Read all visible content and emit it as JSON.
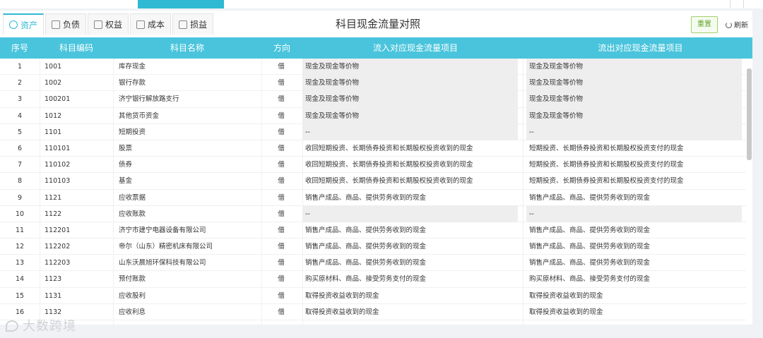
{
  "tabs": [
    {
      "label": "资产",
      "icon": "asset-icon"
    },
    {
      "label": "负债",
      "icon": "liability-icon"
    },
    {
      "label": "权益",
      "icon": "user-icon"
    },
    {
      "label": "成本",
      "icon": "layers-icon"
    },
    {
      "label": "损益",
      "icon": "profit-icon"
    }
  ],
  "page_title": "科目现金流量对照",
  "actions": {
    "reset_label": "重置",
    "refresh_label": "刷新"
  },
  "table": {
    "headers": {
      "no": "序号",
      "code": "科目编码",
      "name": "科目名称",
      "dir": "方向",
      "in": "流入对应现金流量项目",
      "out": "流出对应现金流量项目"
    },
    "rows": [
      {
        "no": "1",
        "code": "1001",
        "name": "库存现金",
        "dir": "借",
        "in": "现金及现金等价物",
        "out": "现金及现金等价物",
        "boxed": true
      },
      {
        "no": "2",
        "code": "1002",
        "name": "银行存款",
        "dir": "借",
        "in": "现金及现金等价物",
        "out": "现金及现金等价物",
        "boxed": true
      },
      {
        "no": "3",
        "code": "100201",
        "name": "济宁银行解放路支行",
        "dir": "借",
        "in": "现金及现金等价物",
        "out": "现金及现金等价物",
        "boxed": true
      },
      {
        "no": "4",
        "code": "1012",
        "name": "其他货币资金",
        "dir": "借",
        "in": "现金及现金等价物",
        "out": "现金及现金等价物",
        "boxed": true
      },
      {
        "no": "5",
        "code": "1101",
        "name": "短期投资",
        "dir": "借",
        "in": "--",
        "out": "--",
        "boxed": true
      },
      {
        "no": "6",
        "code": "110101",
        "name": "股票",
        "dir": "借",
        "in": "收回短期投资、长期债券投资和长期股权投资收到的现金",
        "out": "短期投资、长期债券投资和长期股权投资支付的现金",
        "boxed": false
      },
      {
        "no": "7",
        "code": "110102",
        "name": "债券",
        "dir": "借",
        "in": "收回短期投资、长期债券投资和长期股权投资收到的现金",
        "out": "短期投资、长期债券投资和长期股权投资支付的现金",
        "boxed": false
      },
      {
        "no": "8",
        "code": "110103",
        "name": "基金",
        "dir": "借",
        "in": "收回短期投资、长期债券投资和长期股权投资收到的现金",
        "out": "短期投资、长期债券投资和长期股权投资支付的现金",
        "boxed": false
      },
      {
        "no": "9",
        "code": "1121",
        "name": "应收票据",
        "dir": "借",
        "in": "销售产成品、商品、提供劳务收到的现金",
        "out": "销售产成品、商品、提供劳务收到的现金",
        "boxed": false
      },
      {
        "no": "10",
        "code": "1122",
        "name": "应收账款",
        "dir": "借",
        "in": "--",
        "out": "--",
        "boxed": true
      },
      {
        "no": "11",
        "code": "112201",
        "name": "济宁市建宁电器设备有限公司",
        "dir": "借",
        "in": "销售产成品、商品、提供劳务收到的现金",
        "out": "销售产成品、商品、提供劳务收到的现金",
        "boxed": false
      },
      {
        "no": "12",
        "code": "112202",
        "name": "帝尔（山东）精密机床有限公司",
        "dir": "借",
        "in": "销售产成品、商品、提供劳务收到的现金",
        "out": "销售产成品、商品、提供劳务收到的现金",
        "boxed": false
      },
      {
        "no": "13",
        "code": "112203",
        "name": "山东沃晨旭环保科技有限公司",
        "dir": "借",
        "in": "销售产成品、商品、提供劳务收到的现金",
        "out": "销售产成品、商品、提供劳务收到的现金",
        "boxed": false
      },
      {
        "no": "14",
        "code": "1123",
        "name": "预付账款",
        "dir": "借",
        "in": "购买原材料、商品、接受劳务支付的现金",
        "out": "购买原材料、商品、接受劳务支付的现金",
        "boxed": false
      },
      {
        "no": "15",
        "code": "1131",
        "name": "应收股利",
        "dir": "借",
        "in": "取得投资收益收到的现金",
        "out": "取得投资收益收到的现金",
        "boxed": false
      },
      {
        "no": "16",
        "code": "1132",
        "name": "应收利息",
        "dir": "借",
        "in": "取得投资收益收到的现金",
        "out": "取得投资收益收到的现金",
        "boxed": false
      }
    ]
  },
  "watermark": "大数跨境",
  "colors": {
    "accent": "#49c4dc",
    "tab_active": "#2fb9d2",
    "reset_border": "#9fd26c"
  }
}
